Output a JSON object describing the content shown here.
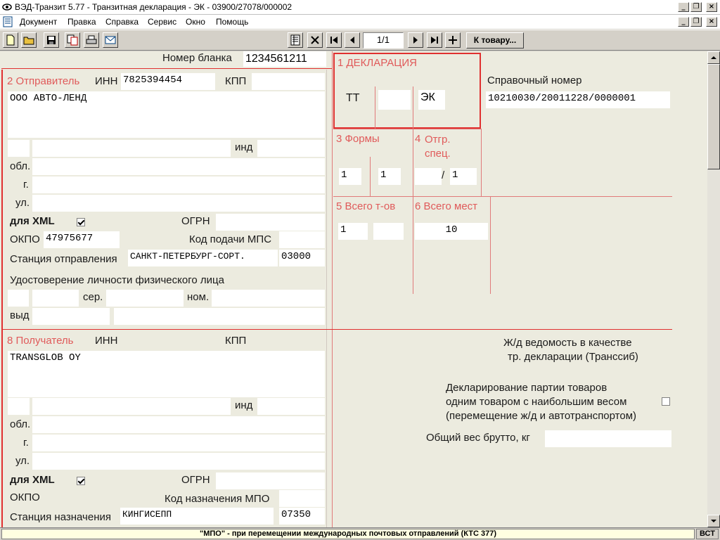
{
  "window": {
    "title": "ВЭД-Транзит 5.77  - Транзитная декларация - ЭК - 03900/27078/000002"
  },
  "menu": [
    "Документ",
    "Правка",
    "Справка",
    "Сервис",
    "Окно",
    "Помощь"
  ],
  "toolbar": {
    "page": "1/1",
    "to_goods": "К товару..."
  },
  "form": {
    "blank_label": "Номер бланка",
    "blank_number": "1234561211",
    "sender": {
      "title": "2 Отправитель",
      "inn_label": "ИНН",
      "inn": "7825394454",
      "kpp_label": "КПП",
      "name": "ООО АВТО-ЛЕНД",
      "ind_label": "инд",
      "obl_label": "обл.",
      "g_label": "г.",
      "ul_label": "ул.",
      "xml_label": "для XML",
      "ogrn_label": "ОГРН",
      "okpo_label": "ОКПО",
      "okpo": "47975677",
      "mps_label": "Код подачи МПС",
      "station_label": "Станция отправления",
      "station": "САНКТ-ПЕТЕРБУРГ-СОРТ.",
      "station_code": "03000",
      "id_label": "Удостоверение личности физического лица",
      "ser_label": "сер.",
      "nom_label": "ном.",
      "vyd_label": "выд"
    },
    "declaration": {
      "title": "1 ДЕКЛАРАЦИЯ",
      "tt": "ТТ",
      "ek": "ЭК"
    },
    "ref": {
      "label": "Справочный номер",
      "value": "10210030/20011228/0000001"
    },
    "forms": {
      "title": "3 Формы",
      "v1": "1",
      "v2": "1"
    },
    "spec": {
      "title_num": "4",
      "title": "Отгр. спец.",
      "slash": "/",
      "v": "1"
    },
    "goods_total": {
      "title": "5 Всего т-ов",
      "v": "1"
    },
    "places_total": {
      "title": "6 Всего мест",
      "v": "10"
    },
    "receiver": {
      "title": "8 Получатель",
      "inn_label": "ИНН",
      "kpp_label": "КПП",
      "name": "TRANSGLOB OY",
      "ind_label": "инд",
      "obl_label": "обл.",
      "g_label": "г.",
      "ul_label": "ул.",
      "xml_label": "для XML",
      "ogrn_label": "ОГРН",
      "okpo_label": "ОКПО",
      "mpo_label": "Код назначения МПО",
      "station_label": "Станция назначения",
      "station": "КИНГИСЕПП",
      "station_code": "07350"
    },
    "right": {
      "rail1": "Ж/д ведомость в качестве",
      "rail2": "тр. декларации (Транссиб)",
      "decl1": "Декларирование партии товаров",
      "decl2": "одним товаром с наибольшим весом",
      "decl3": "(перемещение ж/д и автотранспортом)",
      "weight_label": "Общий вес брутто, кг"
    }
  },
  "status": {
    "main": "\"МПО\" - при перемещении международных почтовых отправлений (КТС 377)",
    "mode": "ВСТ"
  }
}
